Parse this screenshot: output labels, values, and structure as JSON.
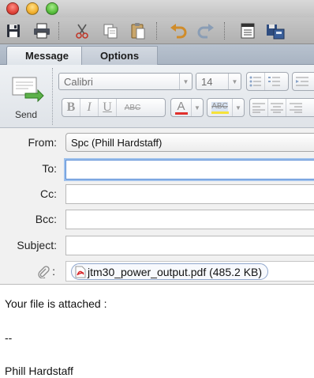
{
  "window": {
    "traffic_lights": [
      "close",
      "minimize",
      "zoom"
    ]
  },
  "toolbar": {
    "icons": [
      "save-icon",
      "print-icon",
      "cut-icon",
      "copy-icon",
      "paste-icon",
      "undo-icon",
      "redo-icon",
      "address-book-icon",
      "check-names-icon"
    ]
  },
  "tabs": [
    {
      "label": "Message",
      "active": true
    },
    {
      "label": "Options",
      "active": false
    }
  ],
  "ribbon": {
    "send_label": "Send",
    "font_name": "Calibri",
    "font_size": "14",
    "format_buttons": [
      "B",
      "I",
      "U",
      "ABC"
    ],
    "highlight_label": "ABC"
  },
  "header": {
    "from_label": "From:",
    "from_value": "Spc (Phill Hardstaff)",
    "to_label": "To:",
    "to_value": "",
    "cc_label": "Cc:",
    "cc_value": "",
    "bcc_label": "Bcc:",
    "bcc_value": "",
    "subject_label": "Subject:",
    "subject_value": "",
    "attach_label": ":",
    "attachment_name": "jtm30_power_output.pdf (485.2 KB)"
  },
  "message_body": {
    "line1": "Your file is attached :",
    "signature_sep": "--",
    "signature_name": "Phill Hardstaff"
  },
  "colors": {
    "accent_focus": "#5b8ed6",
    "pdf_red": "#d6262a",
    "font_color_red": "#e0302c",
    "highlight_yellow": "#f5e23a"
  }
}
